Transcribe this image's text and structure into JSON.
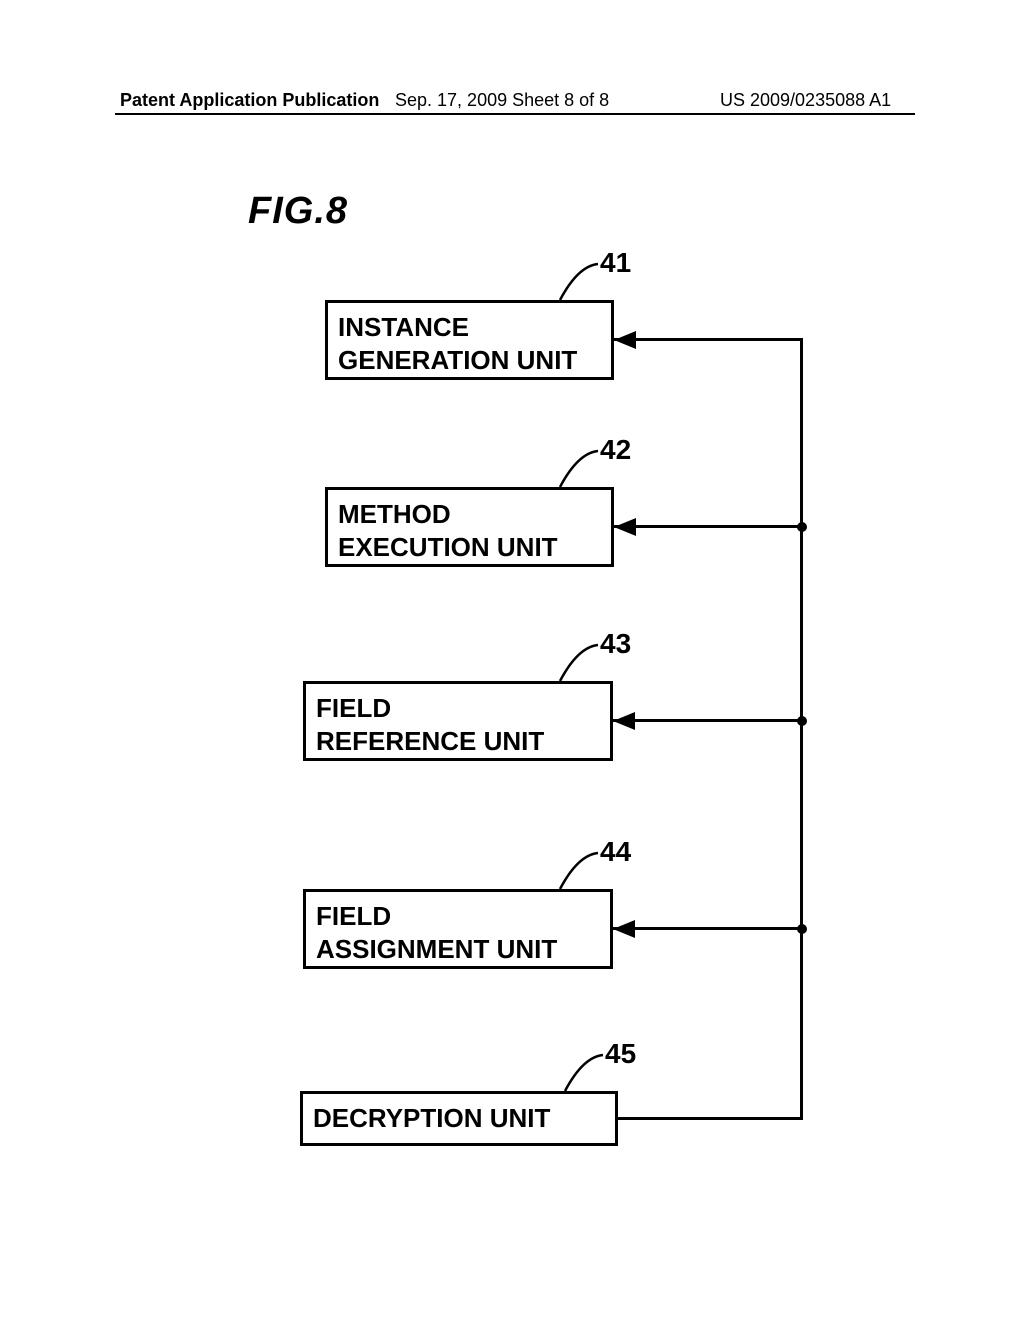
{
  "header": {
    "left": "Patent Application Publication",
    "center": "Sep. 17, 2009  Sheet 8 of 8",
    "right": "US 2009/0235088 A1"
  },
  "figure_label": "FIG.8",
  "blocks": [
    {
      "ref": "41",
      "label": "INSTANCE\nGENERATION UNIT"
    },
    {
      "ref": "42",
      "label": "METHOD\nEXECUTION UNIT"
    },
    {
      "ref": "43",
      "label": "FIELD\nREFERENCE UNIT"
    },
    {
      "ref": "44",
      "label": "FIELD\nASSIGNMENT UNIT"
    },
    {
      "ref": "45",
      "label": "DECRYPTION UNIT"
    }
  ]
}
